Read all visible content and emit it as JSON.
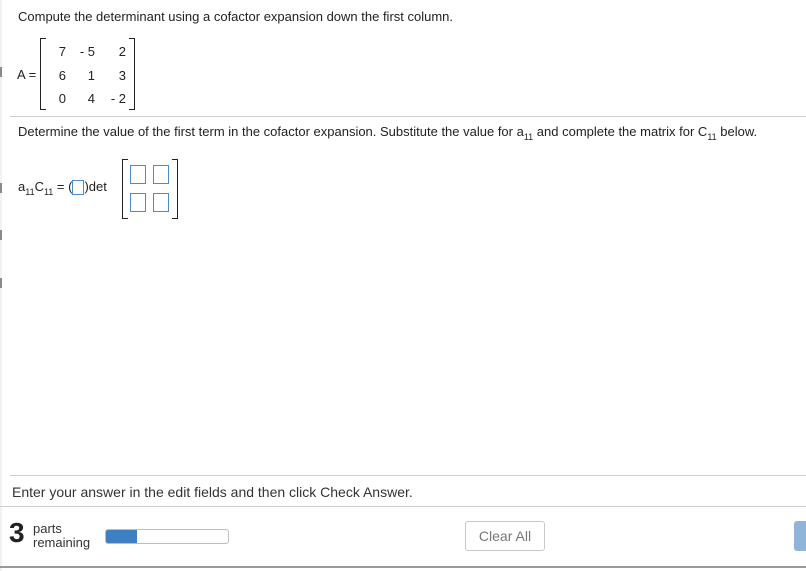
{
  "question": {
    "instruction": "Compute the determinant using a cofactor expansion down the first column.",
    "matrix_label": "A =",
    "matrix": [
      [
        "7",
        "- 5",
        "2"
      ],
      [
        "6",
        "1",
        "3"
      ],
      [
        "0",
        "4",
        "- 2"
      ]
    ],
    "prompt_part1": "Determine the value of the first term in the cofactor expansion. Substitute the value for a",
    "prompt_sub1": "11",
    "prompt_part2": " and complete the matrix for C",
    "prompt_sub2": "11",
    "prompt_part3": " below.",
    "term_a": "a",
    "term_a_sub": "11",
    "term_c": "C",
    "term_c_sub": "11",
    "term_equals": " = (",
    "term_det": ")det"
  },
  "footer": {
    "status_text": "Enter your answer in the edit fields and then click Check Answer.",
    "parts_count": "3",
    "parts_word": "parts",
    "parts_remaining": "remaining",
    "progress_fraction": 0.25,
    "clear_all_label": "Clear All"
  },
  "colors": {
    "input_border": "#4a8ec8",
    "progress_fill": "#3d7fc1",
    "check_answer": "#8fb6d8"
  }
}
